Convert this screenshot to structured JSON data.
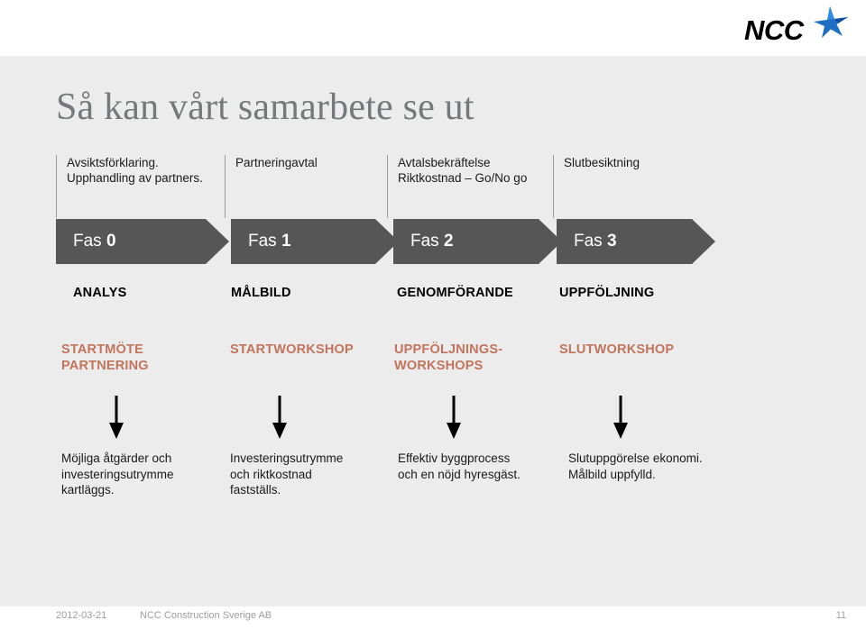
{
  "slide": {
    "title": "Så kan vårt samarbete se ut",
    "background_color": "#ececec",
    "accent_color": "#c2745c",
    "chevron_color": "#565656"
  },
  "logo": {
    "name": "ncc-logo",
    "wordmark": "NCC",
    "star_color": "#1f6fc4",
    "wordmark_color": "#000000"
  },
  "columns": [
    {
      "deliverable": [
        "Avsiktsförklaring.",
        "Upphandling av partners."
      ],
      "phase_prefix": "Fas",
      "phase_number": "0",
      "stage": "ANALYS",
      "workshop": [
        "STARTMÖTE",
        "PARTNERING"
      ],
      "outcome": [
        "Möjliga åtgärder och",
        "investeringsutrymme",
        "kartläggs."
      ]
    },
    {
      "deliverable": [
        "Partneringavtal"
      ],
      "phase_prefix": "Fas",
      "phase_number": "1",
      "stage": "MÅLBILD",
      "workshop": [
        "STARTWORKSHOP"
      ],
      "outcome": [
        "Investeringsutrymme",
        "och riktkostnad",
        "fastställs."
      ]
    },
    {
      "deliverable": [
        "Avtalsbekräftelse",
        "Riktkostnad – Go/No go"
      ],
      "phase_prefix": "Fas",
      "phase_number": "2",
      "stage": "GENOMFÖRANDE",
      "workshop": [
        "UPPFÖLJNINGS-",
        "WORKSHOPS"
      ],
      "outcome": [
        "Effektiv byggprocess",
        "och en nöjd hyresgäst."
      ]
    },
    {
      "deliverable": [
        "Slutbesiktning"
      ],
      "phase_prefix": "Fas",
      "phase_number": "3",
      "stage": "UPPFÖLJNING",
      "workshop": [
        "SLUTWORKSHOP"
      ],
      "outcome": [
        "Slutuppgörelse ekonomi.",
        "Målbild uppfylld."
      ]
    }
  ],
  "footer": {
    "date": "2012-03-21",
    "organization": "NCC Construction Sverige AB",
    "page_number": "11"
  }
}
